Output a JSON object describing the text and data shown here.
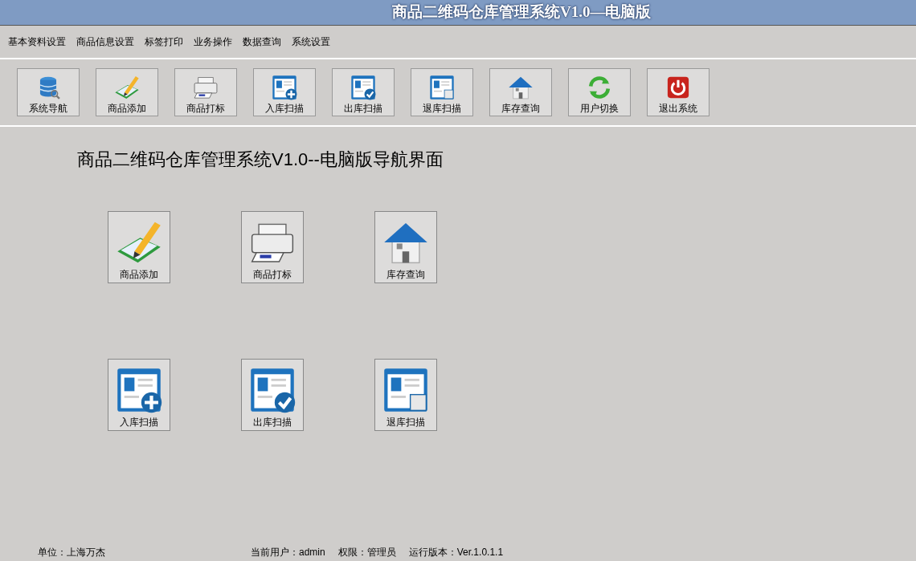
{
  "window": {
    "title": "商品二维码仓库管理系统V1.0—电脑版"
  },
  "menu": [
    "基本资料设置",
    "商品信息设置",
    "标签打印",
    "业务操作",
    "数据查询",
    "系统设置"
  ],
  "toolbar": [
    {
      "label": "系统导航",
      "kind": "database"
    },
    {
      "label": "商品添加",
      "kind": "edit"
    },
    {
      "label": "商品打标",
      "kind": "printer"
    },
    {
      "label": "入库扫描",
      "kind": "doc-plus"
    },
    {
      "label": "出库扫描",
      "kind": "doc-check"
    },
    {
      "label": "退库扫描",
      "kind": "doc-return"
    },
    {
      "label": "库存查询",
      "kind": "house"
    },
    {
      "label": "用户切换",
      "kind": "refresh"
    },
    {
      "label": "退出系统",
      "kind": "power"
    }
  ],
  "heading": "商品二维码仓库管理系统V1.0--电脑版导航界面",
  "nav_buttons": [
    {
      "label": "商品添加",
      "kind": "edit"
    },
    {
      "label": "商品打标",
      "kind": "printer"
    },
    {
      "label": "库存查询",
      "kind": "house"
    },
    {
      "label": "入库扫描",
      "kind": "doc-plus"
    },
    {
      "label": "出库扫描",
      "kind": "doc-check"
    },
    {
      "label": "退库扫描",
      "kind": "doc-return"
    }
  ],
  "status_bar": {
    "unit": "单位：上海万杰",
    "user": "当前用户：admin",
    "role": "权限：管理员",
    "version": "运行版本：Ver.1.0.1.1"
  }
}
